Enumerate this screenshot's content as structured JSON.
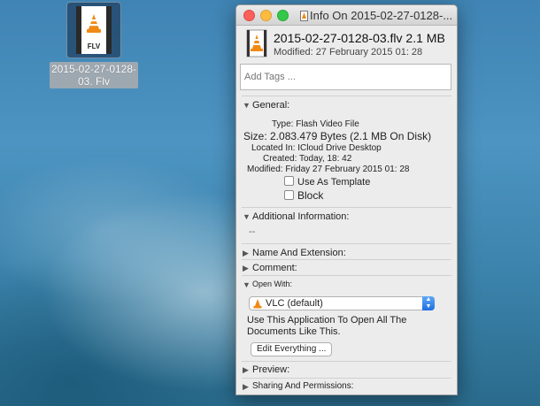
{
  "desktop": {
    "icon_badge": "FLV",
    "icon_label_line1": "2015-02-27-0128-",
    "icon_label_line2": "03. Flv"
  },
  "window": {
    "title": "Info On 2015-02-27-0128-..."
  },
  "header": {
    "file_name": "2015-02-27-0128-03.flv 2.1 MB",
    "modified": "Modified: 27 February 2015 01: 28"
  },
  "tags": {
    "placeholder": "Add Tags ..."
  },
  "general": {
    "heading": "General:",
    "type": "Type: Flash Video File",
    "size": "Size: 2.083.479 Bytes (2.1 MB On Disk)",
    "location": "Located In: ICloud Drive Desktop",
    "created": "Created: Today, 18: 42",
    "modified": "Modified: Friday 27 February 2015 01: 28",
    "use_as_template": "Use As Template",
    "block": "Block"
  },
  "additional": {
    "heading": "Additional Information:",
    "value": "--"
  },
  "name_ext": {
    "heading": "Name And Extension:"
  },
  "comment": {
    "heading": "Comment:"
  },
  "open_with": {
    "heading": "Open With:",
    "selected_app": "VLC (default)",
    "description_line1": "Use This Application To Open All The",
    "description_line2": "Documents Like This.",
    "edit_button": "Edit Everything ..."
  },
  "preview": {
    "heading": "Preview:"
  },
  "sharing": {
    "heading": "Sharing And Permissions:"
  },
  "colors": {
    "close": "#fc605c",
    "minimize": "#fdbc40",
    "zoom": "#34c84a",
    "vlc_orange": "#f08a14",
    "select_accent": "#1f6ee0"
  },
  "icons": [
    "vlc-cone-icon",
    "disclosure-triangle-icon",
    "chevron-updown-icon",
    "checkbox-icon"
  ]
}
